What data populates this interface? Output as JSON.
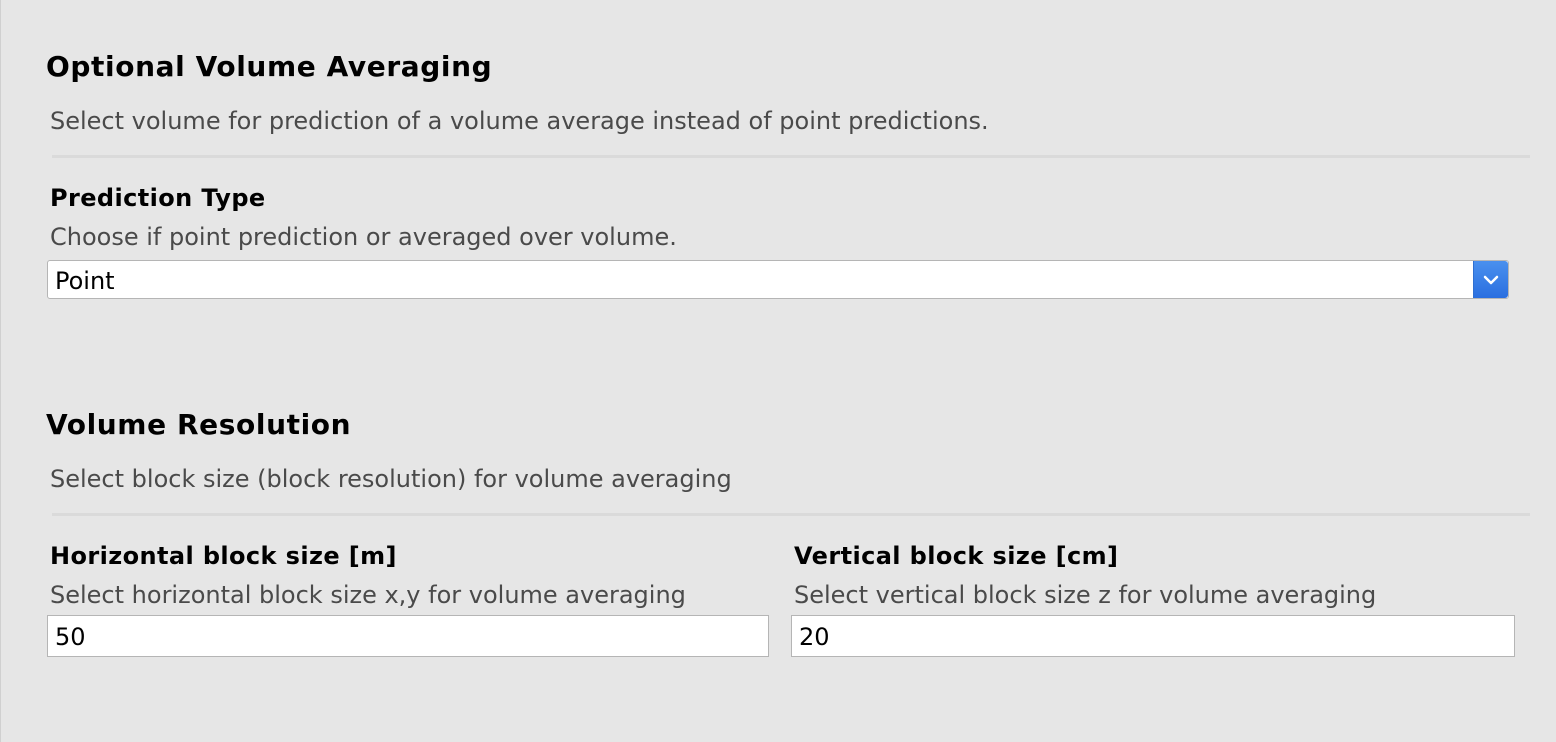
{
  "sections": {
    "volume_averaging": {
      "title": "Optional Volume Averaging",
      "description": "Select volume for prediction of a volume average instead of point predictions."
    },
    "prediction_type": {
      "label": "Prediction Type",
      "description": "Choose if point prediction or averaged over volume.",
      "selected_value": "Point"
    },
    "volume_resolution": {
      "title": "Volume Resolution",
      "description": "Select block size (block resolution) for volume averaging"
    },
    "horizontal_block": {
      "label": "Horizontal block size [m]",
      "description": "Select horizontal block size x,y for volume averaging",
      "value": "50"
    },
    "vertical_block": {
      "label": "Vertical block size [cm]",
      "description": "Select vertical block size z for volume averaging",
      "value": "20"
    }
  },
  "icons": {
    "dropdown": "chevron-down-icon"
  },
  "colors": {
    "background": "#e6e6e6",
    "accent": "#2a6fe0"
  }
}
